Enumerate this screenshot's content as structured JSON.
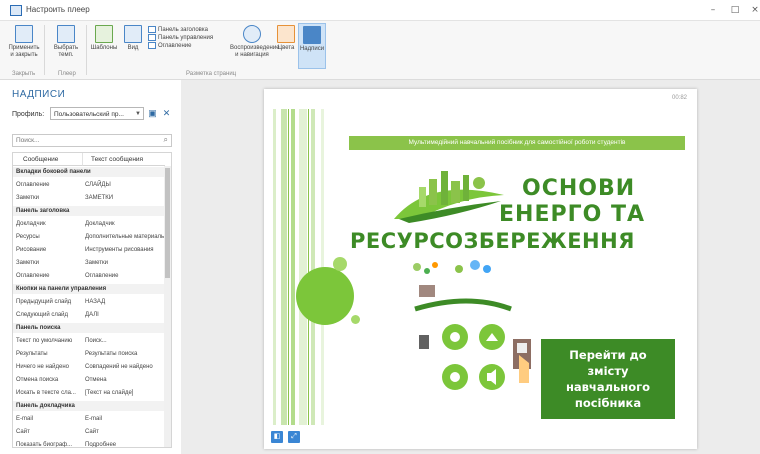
{
  "window": {
    "title": "Настроить плеер",
    "minimize": "–",
    "maximize": "□",
    "close": "×"
  },
  "ribbon": {
    "buttons": [
      {
        "label": "Применить\nи закрыть"
      },
      {
        "label": "Выбрать\nтемп."
      },
      {
        "label": "Шаблоны"
      },
      {
        "label": "Вид"
      }
    ],
    "small_items": [
      "Панель заголовка",
      "Панель управления",
      "Оглавление"
    ],
    "buttons2": [
      {
        "label": "Воспроизведение\nи навигация"
      },
      {
        "label": "Цвета"
      },
      {
        "label": "Надписи"
      }
    ],
    "groups": [
      "Закрыть",
      "Плеер",
      "Разметка страниц"
    ]
  },
  "panel": {
    "title": "НАДПИСИ",
    "profile_label": "Профиль:",
    "profile_value": "Пользовательский пр...",
    "search_placeholder": "Поиск...",
    "columns": [
      "Сообщение",
      "Текст сообщения"
    ],
    "rows": [
      {
        "type": "group",
        "label": "Вкладки боковой панели"
      },
      {
        "type": "item",
        "key": "Оглавление",
        "value": "СЛАЙДЫ"
      },
      {
        "type": "item",
        "key": "Заметки",
        "value": "ЗАМЕТКИ"
      },
      {
        "type": "group",
        "label": "Панель заголовка"
      },
      {
        "type": "item",
        "key": "Докладчик",
        "value": "Докладчик"
      },
      {
        "type": "item",
        "key": "Ресурсы",
        "value": "Дополнительные материалы"
      },
      {
        "type": "item",
        "key": "Рисование",
        "value": "Инструменты рисования"
      },
      {
        "type": "item",
        "key": "Заметки",
        "value": "Заметки"
      },
      {
        "type": "item",
        "key": "Оглавление",
        "value": "Оглавление"
      },
      {
        "type": "group",
        "label": "Кнопки на панели управления"
      },
      {
        "type": "item",
        "key": "Предыдущий слайд",
        "value": "НАЗАД"
      },
      {
        "type": "item",
        "key": "Следующий слайд",
        "value": "ДАЛІ"
      },
      {
        "type": "group",
        "label": "Панель поиска"
      },
      {
        "type": "item",
        "key": "Текст по умолчанию",
        "value": "Поиск..."
      },
      {
        "type": "item",
        "key": "Результаты",
        "value": "Результаты поиска"
      },
      {
        "type": "item",
        "key": "Ничего не найдено",
        "value": "Совпадений не найдено"
      },
      {
        "type": "item",
        "key": "Отмена поиска",
        "value": "Отмена"
      },
      {
        "type": "item",
        "key": "Искать в тексте сла...",
        "value": "[Текст на слайде]"
      },
      {
        "type": "group",
        "label": "Панель докладчика"
      },
      {
        "type": "item",
        "key": "E-mail",
        "value": "E-mail"
      },
      {
        "type": "item",
        "key": "Сайт",
        "value": "Сайт"
      },
      {
        "type": "item",
        "key": "Показать биограф...",
        "value": "Подробнее"
      }
    ]
  },
  "player": {
    "slide_counter": "00:82",
    "banner": "Мультимедійний навчальний посібник для самостійної роботи студентів",
    "title_line1": "ОСНОВИ",
    "title_line2": "ЕНЕРГО ТА",
    "title_line3": "РЕСУРСОЗБЕРЕЖЕННЯ",
    "goto_button": "Перейти до\nзмісту\nнавчального\nпосібника"
  },
  "colors": {
    "accent": "#3a86d4",
    "slide_green": "#3d8b26",
    "banner_green": "#8bc34a",
    "circle_green": "#7cc63a"
  }
}
